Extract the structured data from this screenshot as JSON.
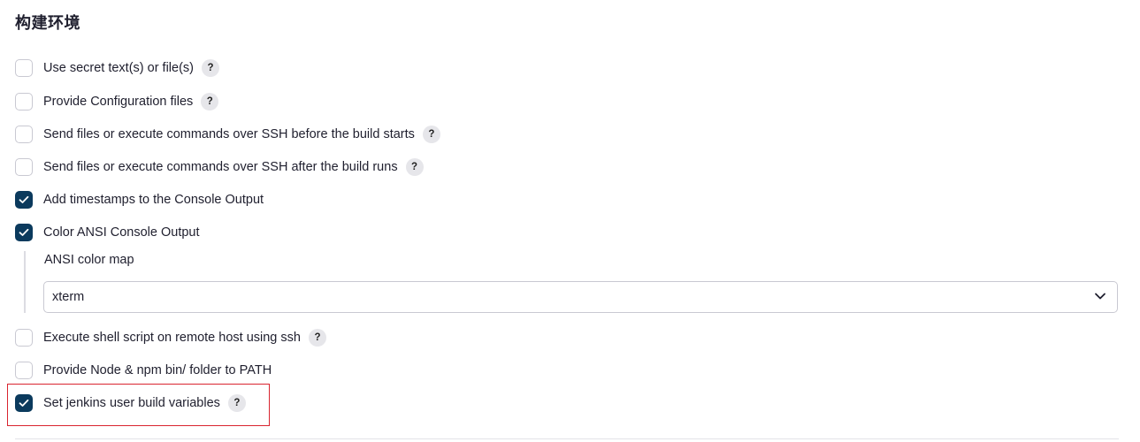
{
  "section": {
    "title": "构建环境"
  },
  "options": [
    {
      "label": "Use secret text(s) or file(s)",
      "checked": false,
      "help": "?"
    },
    {
      "label": "Provide Configuration files",
      "checked": false,
      "help": "?"
    },
    {
      "label": "Send files or execute commands over SSH before the build starts",
      "checked": false,
      "help": "?"
    },
    {
      "label": "Send files or execute commands over SSH after the build runs",
      "checked": false,
      "help": "?"
    },
    {
      "label": "Add timestamps to the Console Output",
      "checked": true
    },
    {
      "label": "Color ANSI Console Output",
      "checked": true
    },
    {
      "label": "Execute shell script on remote host using ssh",
      "checked": false,
      "help": "?"
    },
    {
      "label": "Provide Node & npm bin/ folder to PATH",
      "checked": false
    },
    {
      "label": "Set jenkins user build variables",
      "checked": true,
      "help": "?"
    }
  ],
  "ansi": {
    "label": "ANSI color map",
    "selected": "xterm"
  },
  "colors": {
    "checked": "#0b3a5d",
    "highlight": "#d9242f"
  },
  "icons": {
    "check": "check-icon",
    "chevron": "chevron-down-icon",
    "help": "help-icon"
  }
}
